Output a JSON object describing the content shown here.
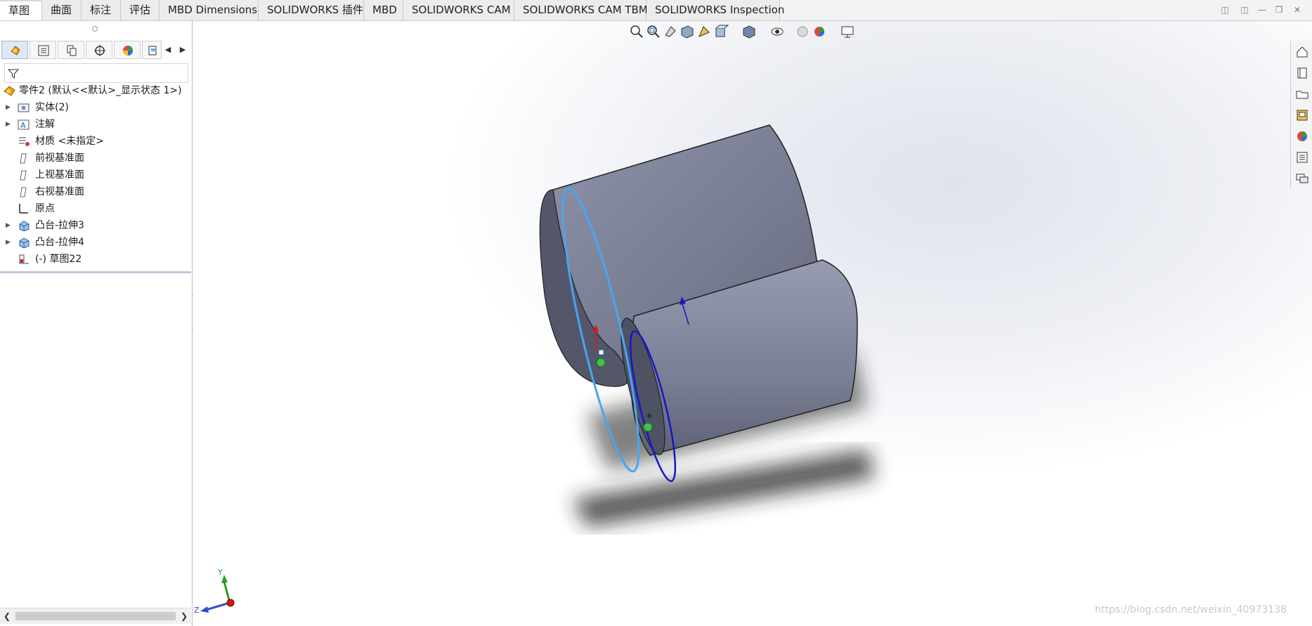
{
  "tabs": [
    "草图",
    "曲面",
    "标注",
    "评估",
    "MBD Dimensions",
    "SOLIDWORKS 插件",
    "MBD",
    "SOLIDWORKS CAM",
    "SOLIDWORKS CAM TBM",
    "SOLIDWORKS Inspection"
  ],
  "active_tab": "草图",
  "feature_tree": {
    "root": "零件2 (默认<<默认>_显示状态 1>)",
    "items": [
      {
        "label": "实体(2)",
        "icon": "solid-bodies-folder-icon",
        "expandable": true
      },
      {
        "label": "注解",
        "icon": "annotations-icon",
        "expandable": true
      },
      {
        "label": "材质 <未指定>",
        "icon": "material-icon",
        "expandable": false
      },
      {
        "label": "前视基准面",
        "icon": "plane-icon",
        "expandable": false
      },
      {
        "label": "上视基准面",
        "icon": "plane-icon",
        "expandable": false
      },
      {
        "label": "右视基准面",
        "icon": "plane-icon",
        "expandable": false
      },
      {
        "label": "原点",
        "icon": "origin-icon",
        "expandable": false
      },
      {
        "label": "凸台-拉伸3",
        "icon": "boss-extrude-icon",
        "expandable": true
      },
      {
        "label": "凸台-拉伸4",
        "icon": "boss-extrude-icon",
        "expandable": true
      },
      {
        "label": "(-) 草图22",
        "icon": "sketch-icon",
        "expandable": false
      }
    ]
  },
  "panel_tabs": [
    "feature-manager-icon",
    "property-manager-icon",
    "configuration-manager-icon",
    "dimxpert-icon",
    "display-manager-icon",
    "cam-icon"
  ],
  "triad": {
    "y": "Y",
    "z": "Z"
  },
  "watermark": "https://blog.csdn.net/weixin_40973138",
  "colors": {
    "body": "#7d8197",
    "sketch_light": "#47a6f0",
    "sketch_dark": "#1616c8",
    "accent": "#1f63b8"
  }
}
